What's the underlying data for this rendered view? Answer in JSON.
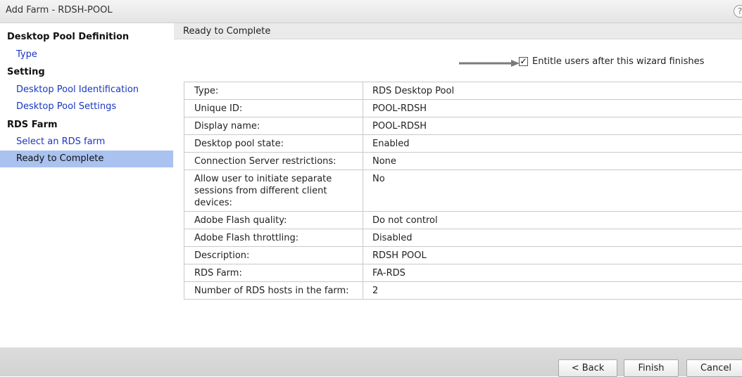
{
  "window": {
    "title": "Add Farm - RDSH-POOL",
    "help_glyph": "?"
  },
  "sidebar": {
    "headings": [
      "Desktop Pool Definition",
      "Setting",
      "RDS Farm"
    ],
    "items": [
      {
        "label": "Type"
      },
      {
        "label": "Desktop Pool Identification"
      },
      {
        "label": "Desktop Pool Settings"
      },
      {
        "label": "Select an RDS farm"
      },
      {
        "label": "Ready to Complete",
        "active": true
      }
    ]
  },
  "main": {
    "header": "Ready to Complete",
    "entitle_label": "Entitle users after this wizard finishes",
    "entitle_checked": true,
    "check_glyph": "✓",
    "summary": [
      {
        "key": "Type:",
        "value": "RDS Desktop Pool"
      },
      {
        "key": "Unique ID:",
        "value": "POOL-RDSH"
      },
      {
        "key": "Display name:",
        "value": "POOL-RDSH"
      },
      {
        "key": "Desktop pool state:",
        "value": "Enabled"
      },
      {
        "key": "Connection Server restrictions:",
        "value": "None"
      },
      {
        "key": "Allow user to initiate separate sessions from different client devices:",
        "value": "No"
      },
      {
        "key": "Adobe Flash quality:",
        "value": "Do not control"
      },
      {
        "key": "Adobe Flash throttling:",
        "value": "Disabled"
      },
      {
        "key": "Description:",
        "value": "RDSH POOL"
      },
      {
        "key": "RDS Farm:",
        "value": "FA-RDS"
      },
      {
        "key": "Number of RDS hosts in the farm:",
        "value": "2"
      }
    ]
  },
  "footer": {
    "back_label": "< Back",
    "finish_label": "Finish",
    "cancel_label": "Cancel"
  },
  "colors": {
    "active_nav_bg": "#a9c2f0",
    "link_color": "#1a37c0",
    "arrow_color": "#7a7a7a"
  }
}
